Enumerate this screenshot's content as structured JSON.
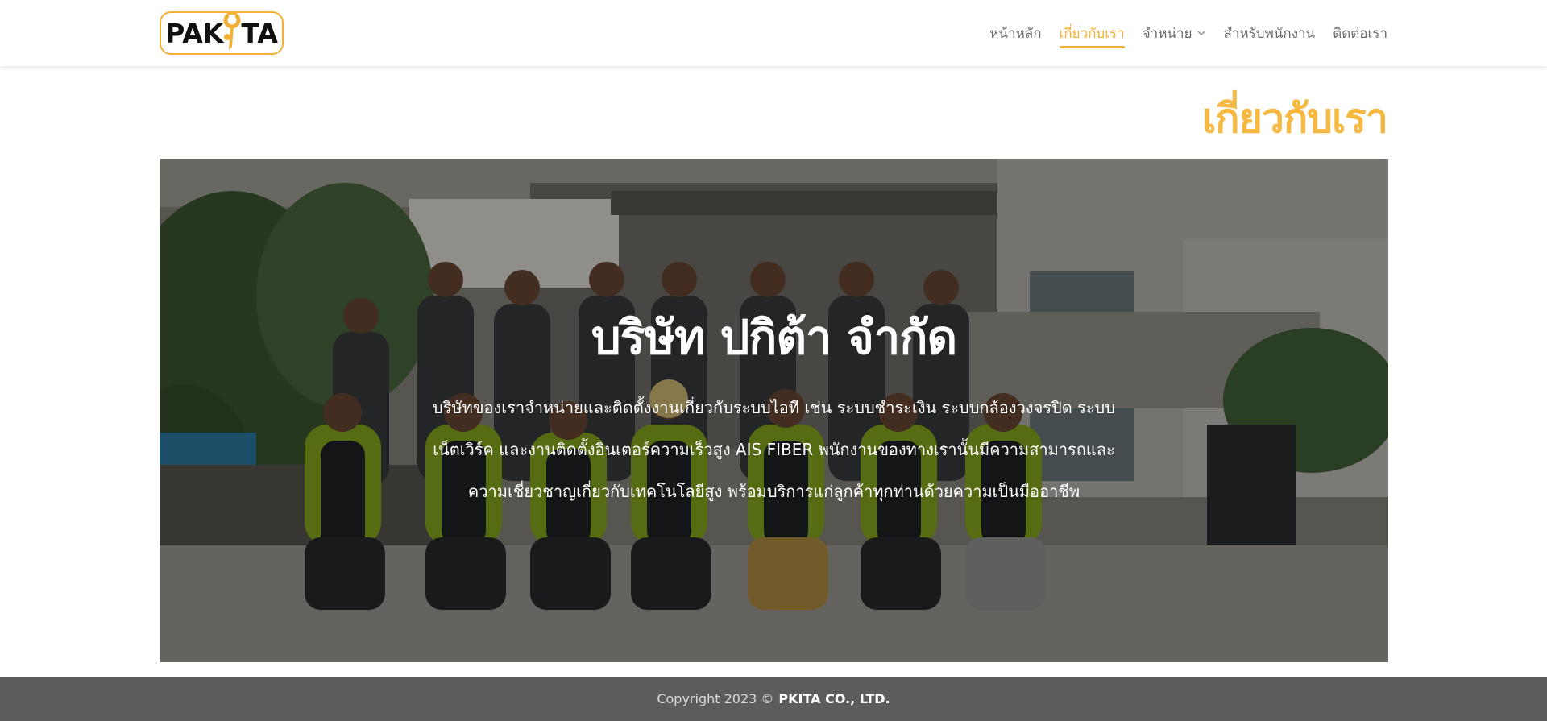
{
  "brand": {
    "logo_left": "PAK",
    "logo_right": "TA",
    "accent_color": "#f2b035"
  },
  "nav": {
    "items": [
      {
        "label": "หน้าหลัก",
        "active": false
      },
      {
        "label": "เกี่ยวกับเรา",
        "active": true
      },
      {
        "label": "จำหน่าย",
        "active": false,
        "has_dropdown": true
      },
      {
        "label": "สำหรับพนักงาน",
        "active": false
      },
      {
        "label": "ติดต่อเรา",
        "active": false
      }
    ]
  },
  "page": {
    "title": "เกี่ยวกับเรา"
  },
  "hero": {
    "heading": "บริษัท ปกิต้า จำกัด",
    "lines": [
      "บริษัทของเราจำหน่ายและติดตั้งงานเกี่ยวกับระบบไอที เช่น ระบบชำระเงิน ระบบกล้องวงจรปิด ระบบ",
      "เน็ตเวิร์ค และงานติดตั้งอินเตอร์ความเร็วสูง AIS FIBER  พนักงานของทางเรานั้นมีความสามารถและ",
      "ความเชี่ยวชาญเกี่ยวกับเทคโนโลยีสูง พร้อมบริการแก่ลูกค้าทุกท่านด้วยความเป็นมืออาชีพ"
    ]
  },
  "footer": {
    "copyright_prefix": "Copyright 2023 ©",
    "company": "PKITA CO., LTD."
  }
}
